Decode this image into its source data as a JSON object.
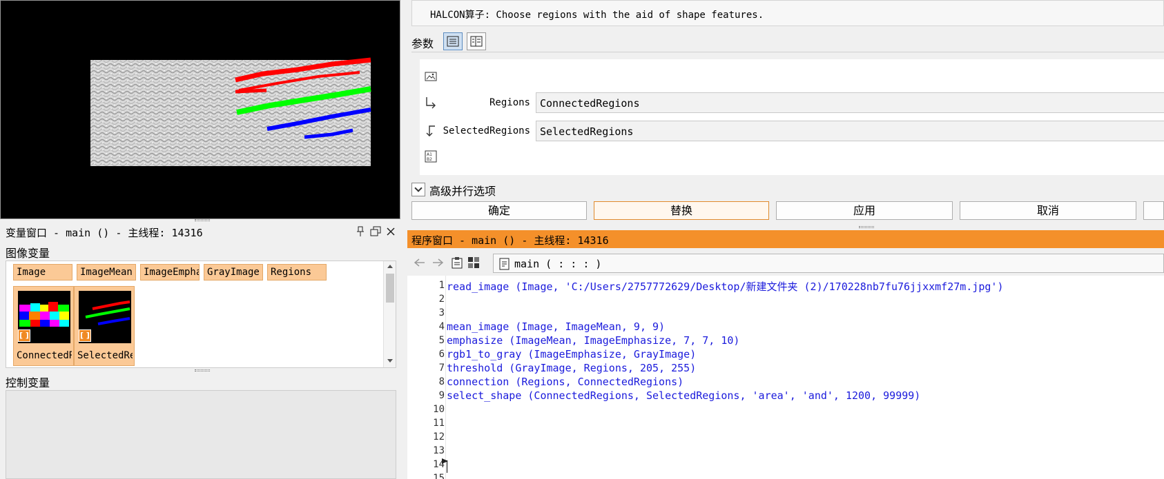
{
  "operator": {
    "description": "HALCON算子: Choose regions with the aid of shape features.",
    "params_label": "参数",
    "params": [
      {
        "label": "",
        "value": "",
        "icon": "image-icon"
      },
      {
        "label": "Regions",
        "value": "ConnectedRegions",
        "icon": "input-arrow-icon"
      },
      {
        "label": "SelectedRegions",
        "value": "SelectedRegions",
        "icon": "output-arrow-icon"
      },
      {
        "label": "",
        "value": "",
        "icon": "control-params-icon"
      }
    ],
    "advanced_label": "高级并行选项",
    "buttons": {
      "ok": "确定",
      "replace": "替换",
      "apply": "应用",
      "cancel": "取消"
    }
  },
  "variables": {
    "title": "变量窗口 - main () - 主线程: 14316",
    "image_vars_label": "图像变量",
    "image_chips": [
      "Image",
      "ImageMean",
      "ImageEmpha",
      "GrayImage",
      "Regions"
    ],
    "image_thumbs": [
      {
        "name": "ConnectedR",
        "badge": "[ ]"
      },
      {
        "name": "SelectedRe",
        "badge": "[ ]"
      }
    ],
    "control_vars_label": "控制变量"
  },
  "program": {
    "title": "程序窗口 - main () - 主线程: 14316",
    "procedure": "main ( : : : )",
    "lines": [
      {
        "n": "1",
        "code": "read_image (Image, 'C:/Users/2757772629/Desktop/新建文件夹 (2)/170228nb7fu76jjxxmf27m.jpg')"
      },
      {
        "n": "2",
        "code": ""
      },
      {
        "n": "3",
        "code": ""
      },
      {
        "n": "4",
        "code": "mean_image (Image, ImageMean, 9, 9)"
      },
      {
        "n": "5",
        "code": "emphasize (ImageMean, ImageEmphasize, 7, 7, 10)"
      },
      {
        "n": "6",
        "code": "rgb1_to_gray (ImageEmphasize, GrayImage)"
      },
      {
        "n": "7",
        "code": "threshold (GrayImage, Regions, 205, 255)"
      },
      {
        "n": "8",
        "code": "connection (Regions, ConnectedRegions)"
      },
      {
        "n": "9",
        "code": "select_shape (ConnectedRegions, SelectedRegions, 'area', 'and', 1200, 99999)"
      },
      {
        "n": "10",
        "code": ""
      },
      {
        "n": "11",
        "code": ""
      },
      {
        "n": "12",
        "code": ""
      },
      {
        "n": "13",
        "code": ""
      },
      {
        "n": "14",
        "code": ""
      },
      {
        "n": "15",
        "code": ""
      }
    ]
  },
  "colors": {
    "accent": "#f4902a",
    "code": "#1a1adc",
    "chip": "#fbc996"
  }
}
